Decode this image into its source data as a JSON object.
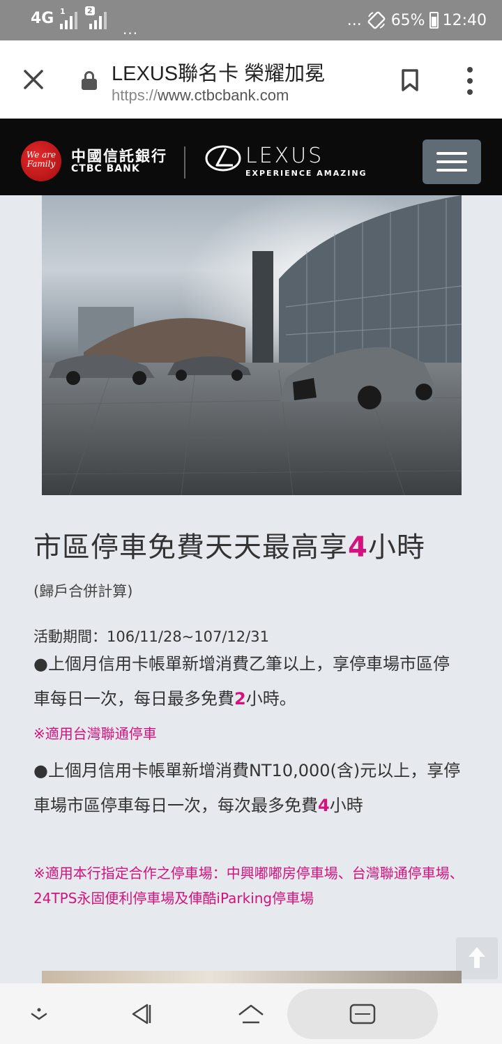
{
  "status_bar": {
    "network": "4G",
    "sim1": "1",
    "sim2": "2",
    "more": "...",
    "right_more": "...",
    "battery": "65%",
    "time": "12:40"
  },
  "browser": {
    "title": "LEXUS聯名卡 榮耀加冕",
    "url_scheme": "https://",
    "url_host": "www.ctbcbank.com"
  },
  "header": {
    "ctbc_logo_text": "We are Family",
    "ctbc_name_zh": "中國信託銀行",
    "ctbc_name_en": "CTBC BANK",
    "lexus_word": "LEXUS",
    "lexus_tagline": "EXPERIENCE AMAZING"
  },
  "promo": {
    "title_pre": "市區停車免費天天最高享",
    "title_num": "4",
    "title_post": "小時",
    "subtitle": "(歸戶合併計算)",
    "period": "活動期間：106/11/28~107/12/31",
    "bullet1_pre": "●上個月信用卡帳單新增消費乙筆以上，享停車場市區停車每日一次，每日最多免費",
    "bullet1_num": "2",
    "bullet1_post": "小時。",
    "note1": "※適用台灣聯通停車",
    "bullet2_pre": "●上個月信用卡帳單新增消費NT10,000(含)元以上，享停車場市區停車每日一次，每次最多免費",
    "bullet2_num": "4",
    "bullet2_post": "小時",
    "note2": "※適用本行指定合作之停車場：中興嘟嘟房停車場、台灣聯通停車場、24TPS永固便利停車場及俥酷iParking停車場"
  },
  "colors": {
    "accent": "#d3127c",
    "header_bg": "#0b0b0b",
    "page_bg": "#e6e9ee"
  }
}
